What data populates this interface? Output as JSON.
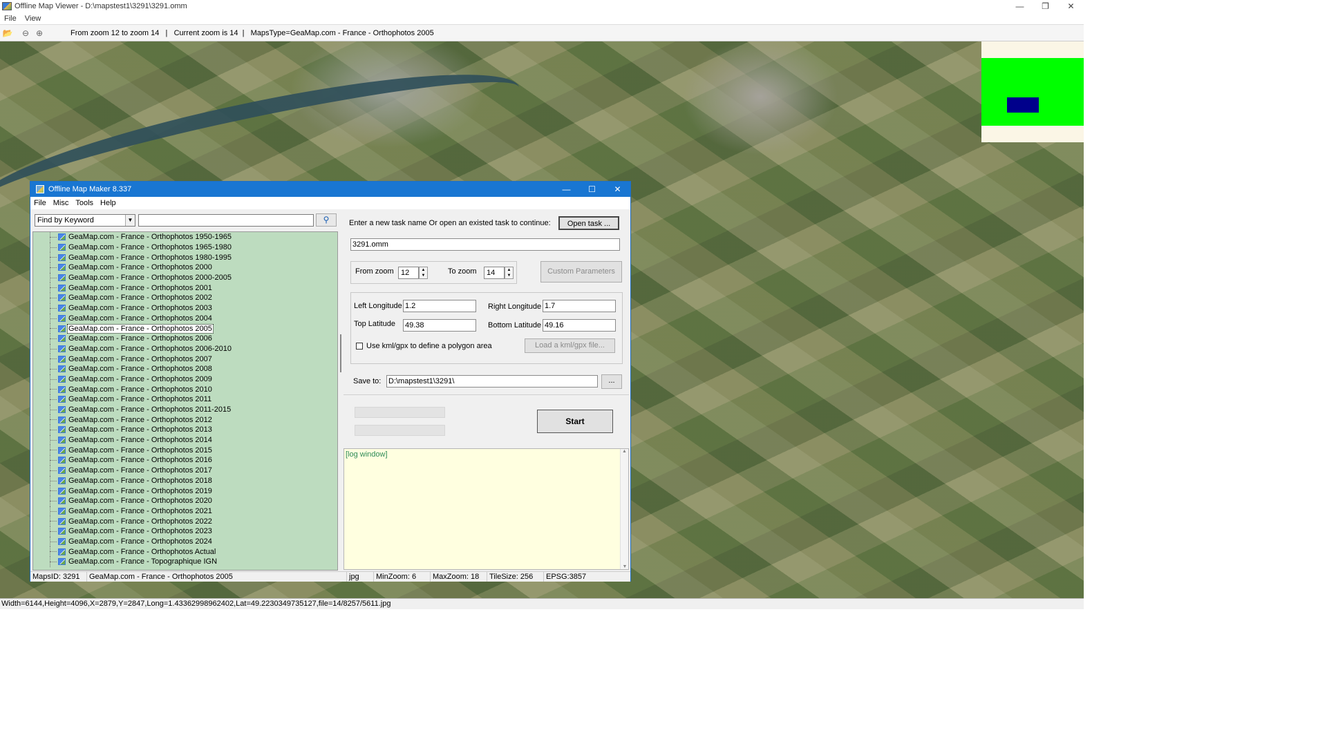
{
  "viewer": {
    "title": "Offline Map Viewer - D:\\mapstest1\\3291\\3291.omm",
    "menu": [
      "File",
      "View"
    ],
    "toolbar_info": "From zoom 12 to zoom 14   |   Current zoom is 14  |   MapsType=GeaMap.com - France - Orthophotos 2005",
    "status": "Width=6144,Height=4096,X=2879,Y=2847,Long=1.43362998962402,Lat=49.2230349735127,file=14/8257/5611.jpg"
  },
  "dialog": {
    "title": "Offline Map Maker 8.337",
    "menu": [
      "File",
      "Misc",
      "Tools",
      "Help"
    ],
    "search": {
      "mode": "Find by Keyword",
      "query": ""
    },
    "tree_items": [
      "GeaMap.com - France - Orthophotos 1950-1965",
      "GeaMap.com - France - Orthophotos 1965-1980",
      "GeaMap.com - France - Orthophotos 1980-1995",
      "GeaMap.com - France - Orthophotos 2000",
      "GeaMap.com - France - Orthophotos 2000-2005",
      "GeaMap.com - France - Orthophotos 2001",
      "GeaMap.com - France - Orthophotos 2002",
      "GeaMap.com - France - Orthophotos 2003",
      "GeaMap.com - France - Orthophotos 2004",
      "GeaMap.com - France - Orthophotos 2005",
      "GeaMap.com - France - Orthophotos 2006",
      "GeaMap.com - France - Orthophotos 2006-2010",
      "GeaMap.com - France - Orthophotos 2007",
      "GeaMap.com - France - Orthophotos 2008",
      "GeaMap.com - France - Orthophotos 2009",
      "GeaMap.com - France - Orthophotos 2010",
      "GeaMap.com - France - Orthophotos 2011",
      "GeaMap.com - France - Orthophotos 2011-2015",
      "GeaMap.com - France - Orthophotos 2012",
      "GeaMap.com - France - Orthophotos 2013",
      "GeaMap.com - France - Orthophotos 2014",
      "GeaMap.com - France - Orthophotos 2015",
      "GeaMap.com - France - Orthophotos 2016",
      "GeaMap.com - France - Orthophotos 2017",
      "GeaMap.com - France - Orthophotos 2018",
      "GeaMap.com - France - Orthophotos 2019",
      "GeaMap.com - France - Orthophotos 2020",
      "GeaMap.com - France - Orthophotos 2021",
      "GeaMap.com - France - Orthophotos 2022",
      "GeaMap.com - France - Orthophotos 2023",
      "GeaMap.com - France - Orthophotos 2024",
      "GeaMap.com - France - Orthophotos Actual",
      "GeaMap.com - France - Topographique IGN"
    ],
    "selected_index": 9,
    "task_prompt": "Enter a new task name Or open an existed task to continue:",
    "open_task_label": "Open task ...",
    "task_name": "3291.omm",
    "from_zoom_label": "From zoom",
    "from_zoom": "12",
    "to_zoom_label": "To zoom",
    "to_zoom": "14",
    "custom_params_label": "Custom Parameters",
    "left_lon_label": "Left Longitude",
    "left_lon": "1.2",
    "right_lon_label": "Right Longitude",
    "right_lon": "1.7",
    "top_lat_label": "Top Latitude",
    "top_lat": "49.38",
    "bottom_lat_label": "Bottom Latitude",
    "bottom_lat": "49.16",
    "kml_checkbox_label": "Use kml/gpx to define a polygon area",
    "load_kml_label": "Load a kml/gpx file...",
    "save_to_label": "Save to:",
    "save_to": "D:\\mapstest1\\3291\\",
    "browse_label": "...",
    "start_label": "Start",
    "log_text": "[log window]",
    "status": {
      "maps_id": "MapsID: 3291",
      "map_name": "GeaMap.com - France - Orthophotos 2005",
      "format": "jpg",
      "min_zoom": "MinZoom: 6",
      "max_zoom": "MaxZoom: 18",
      "tile_size": "TileSize: 256",
      "epsg": "EPSG:3857"
    }
  },
  "colors": {
    "tree_bg": "#bddcbf",
    "dialog_title": "#1976d2",
    "log_bg": "#ffffe0",
    "minimap_green": "#00ff00",
    "minimap_box": "#00008b"
  }
}
